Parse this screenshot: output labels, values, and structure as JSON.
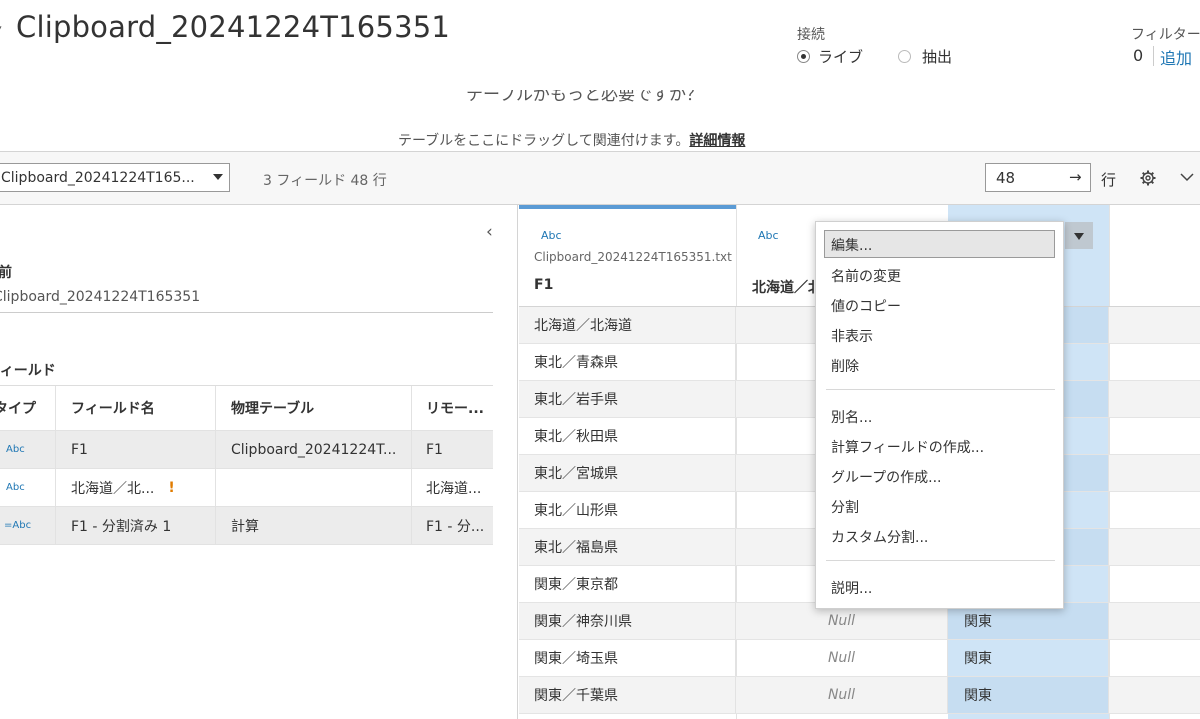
{
  "header": {
    "title": "Clipboard_20241224T165351",
    "connection": {
      "label": "接続",
      "live": "ライブ",
      "extract": "抽出"
    },
    "filters": {
      "label": "フィルター",
      "count": "0",
      "add": "追加"
    }
  },
  "canvas": {
    "cut_text": "テーブルがもっと必要ですか？",
    "drag_hint": "テーブルをここにドラッグして関連付けます。",
    "detail_link": "詳細情報"
  },
  "toolbar": {
    "table_select": "Clipboard_20241224T165...",
    "field_count": "3 フィールド 48 行",
    "rows_value": "48",
    "rows_arrow": "→",
    "rows_label": "行"
  },
  "left_pane": {
    "name_label": "名前",
    "name_value": "Clipboard_20241224T165351",
    "fields_label": "フィールド",
    "table": {
      "headers": [
        "タイプ",
        "フィールド名",
        "物理テーブル",
        "リモー..."
      ],
      "rows": [
        {
          "type": "Abc",
          "name": "F1",
          "table": "Clipboard_20241224T...",
          "remote": "F1"
        },
        {
          "type": "Abc",
          "name": "北海道／北...",
          "table": "",
          "remote": "北海道...",
          "warning": "!"
        },
        {
          "type": "=Abc",
          "name": "F1 - 分割済み 1",
          "table": "計算",
          "remote": "F1 - 分..."
        }
      ]
    }
  },
  "grid": {
    "col1": {
      "type": "Abc",
      "source": "Clipboard_20241224T165351.txt",
      "name": "F1"
    },
    "col2": {
      "type": "Abc",
      "name": "北海道／北海道"
    },
    "rows": [
      {
        "c1": "北海道／北海道",
        "c2": "",
        "c3": ""
      },
      {
        "c1": "東北／青森県",
        "c2": "",
        "c3": ""
      },
      {
        "c1": "東北／岩手県",
        "c2": "",
        "c3": ""
      },
      {
        "c1": "東北／秋田県",
        "c2": "",
        "c3": ""
      },
      {
        "c1": "東北／宮城県",
        "c2": "",
        "c3": ""
      },
      {
        "c1": "東北／山形県",
        "c2": "",
        "c3": ""
      },
      {
        "c1": "東北／福島県",
        "c2": "",
        "c3": ""
      },
      {
        "c1": "関東／東京都",
        "c2": "",
        "c3": ""
      },
      {
        "c1": "関東／神奈川県",
        "c2": "Null",
        "c3": "関東"
      },
      {
        "c1": "関東／埼玉県",
        "c2": "Null",
        "c3": "関東"
      },
      {
        "c1": "関東／千葉県",
        "c2": "Null",
        "c3": "関東"
      }
    ]
  },
  "context_menu": {
    "items": [
      "編集...",
      "名前の変更",
      "値のコピー",
      "非表示",
      "削除",
      "別名...",
      "計算フィールドの作成...",
      "グループの作成...",
      "分割",
      "カスタム分割...",
      "説明..."
    ]
  },
  "icons": {
    "gear": "gear-icon",
    "chevron": "chevron-down-icon",
    "collapse": "chevron-left-icon"
  },
  "colors": {
    "accent": "#1f77b4",
    "selected_column": "#cfe4f6",
    "column_top_bar": "#5b9bd5",
    "warning": "#e07b00"
  }
}
